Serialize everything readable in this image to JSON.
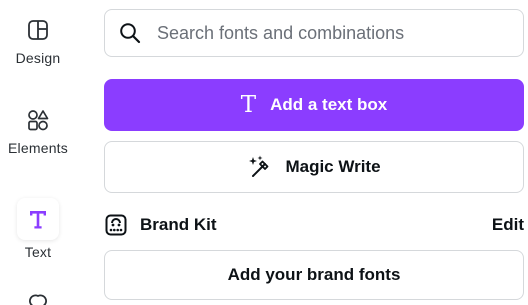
{
  "rail": {
    "items": [
      {
        "label": "Design",
        "icon": "design-icon"
      },
      {
        "label": "Elements",
        "icon": "elements-icon"
      },
      {
        "label": "Text",
        "icon": "text-icon",
        "active": true
      }
    ]
  },
  "search": {
    "placeholder": "Search fonts and combinations",
    "value": ""
  },
  "buttons": {
    "add_text_box": "Add a text box",
    "magic_write": "Magic Write",
    "add_brand_fonts": "Add your brand fonts"
  },
  "brand_kit": {
    "title": "Brand Kit",
    "edit_label": "Edit"
  },
  "colors": {
    "accent": "#8b3dff",
    "border": "#d5d8db",
    "text": "#0d1216"
  }
}
